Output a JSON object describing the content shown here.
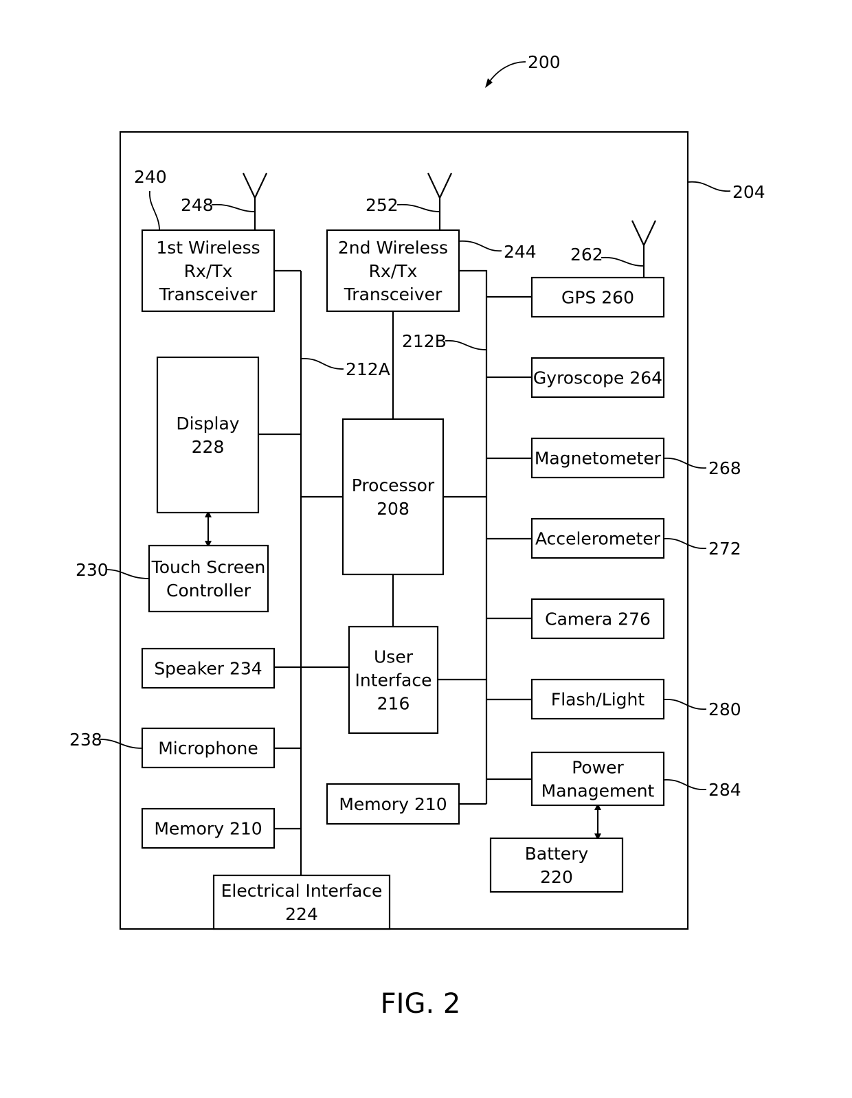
{
  "figure": {
    "caption": "FIG. 2",
    "system_ref": "200",
    "device_ref": "204"
  },
  "blocks": [
    {
      "id": "wireless1",
      "lines": [
        "1st Wireless",
        "Rx/Tx",
        "Transceiver"
      ],
      "ref": "240"
    },
    {
      "id": "wireless2",
      "lines": [
        "2nd Wireless",
        "Rx/Tx",
        "Transceiver"
      ],
      "ref": "244"
    },
    {
      "id": "gps",
      "lines": [
        "GPS 260"
      ],
      "ref": ""
    },
    {
      "id": "gyroscope",
      "lines": [
        "Gyroscope 264"
      ],
      "ref": ""
    },
    {
      "id": "magnetometer",
      "lines": [
        "Magnetometer"
      ],
      "ref": "268"
    },
    {
      "id": "accelerometer",
      "lines": [
        "Accelerometer"
      ],
      "ref": "272"
    },
    {
      "id": "camera",
      "lines": [
        "Camera 276"
      ],
      "ref": ""
    },
    {
      "id": "flash",
      "lines": [
        "Flash/Light"
      ],
      "ref": "280"
    },
    {
      "id": "power",
      "lines": [
        "Power",
        "Management"
      ],
      "ref": "284"
    },
    {
      "id": "battery",
      "lines": [
        "Battery",
        "220"
      ],
      "ref": ""
    },
    {
      "id": "display",
      "lines": [
        "Display",
        "228"
      ],
      "ref": ""
    },
    {
      "id": "touch",
      "lines": [
        "Touch Screen",
        "Controller"
      ],
      "ref": "230"
    },
    {
      "id": "processor",
      "lines": [
        "Processor",
        "208"
      ],
      "ref": ""
    },
    {
      "id": "ui",
      "lines": [
        "User",
        "Interface",
        "216"
      ],
      "ref": ""
    },
    {
      "id": "speaker",
      "lines": [
        "Speaker 234"
      ],
      "ref": ""
    },
    {
      "id": "microphone",
      "lines": [
        "Microphone"
      ],
      "ref": "238"
    },
    {
      "id": "memory_left",
      "lines": [
        "Memory 210"
      ],
      "ref": ""
    },
    {
      "id": "memory_mid",
      "lines": [
        "Memory 210"
      ],
      "ref": ""
    },
    {
      "id": "electrical",
      "lines": [
        "Electrical Interface",
        "224"
      ],
      "ref": ""
    }
  ],
  "antennas": [
    {
      "id": "antenna1",
      "ref": "248"
    },
    {
      "id": "antenna2",
      "ref": "252"
    },
    {
      "id": "antenna_gps",
      "ref": "262"
    }
  ],
  "buses": [
    {
      "id": "bus_a",
      "ref": "212A"
    },
    {
      "id": "bus_b",
      "ref": "212B"
    }
  ]
}
